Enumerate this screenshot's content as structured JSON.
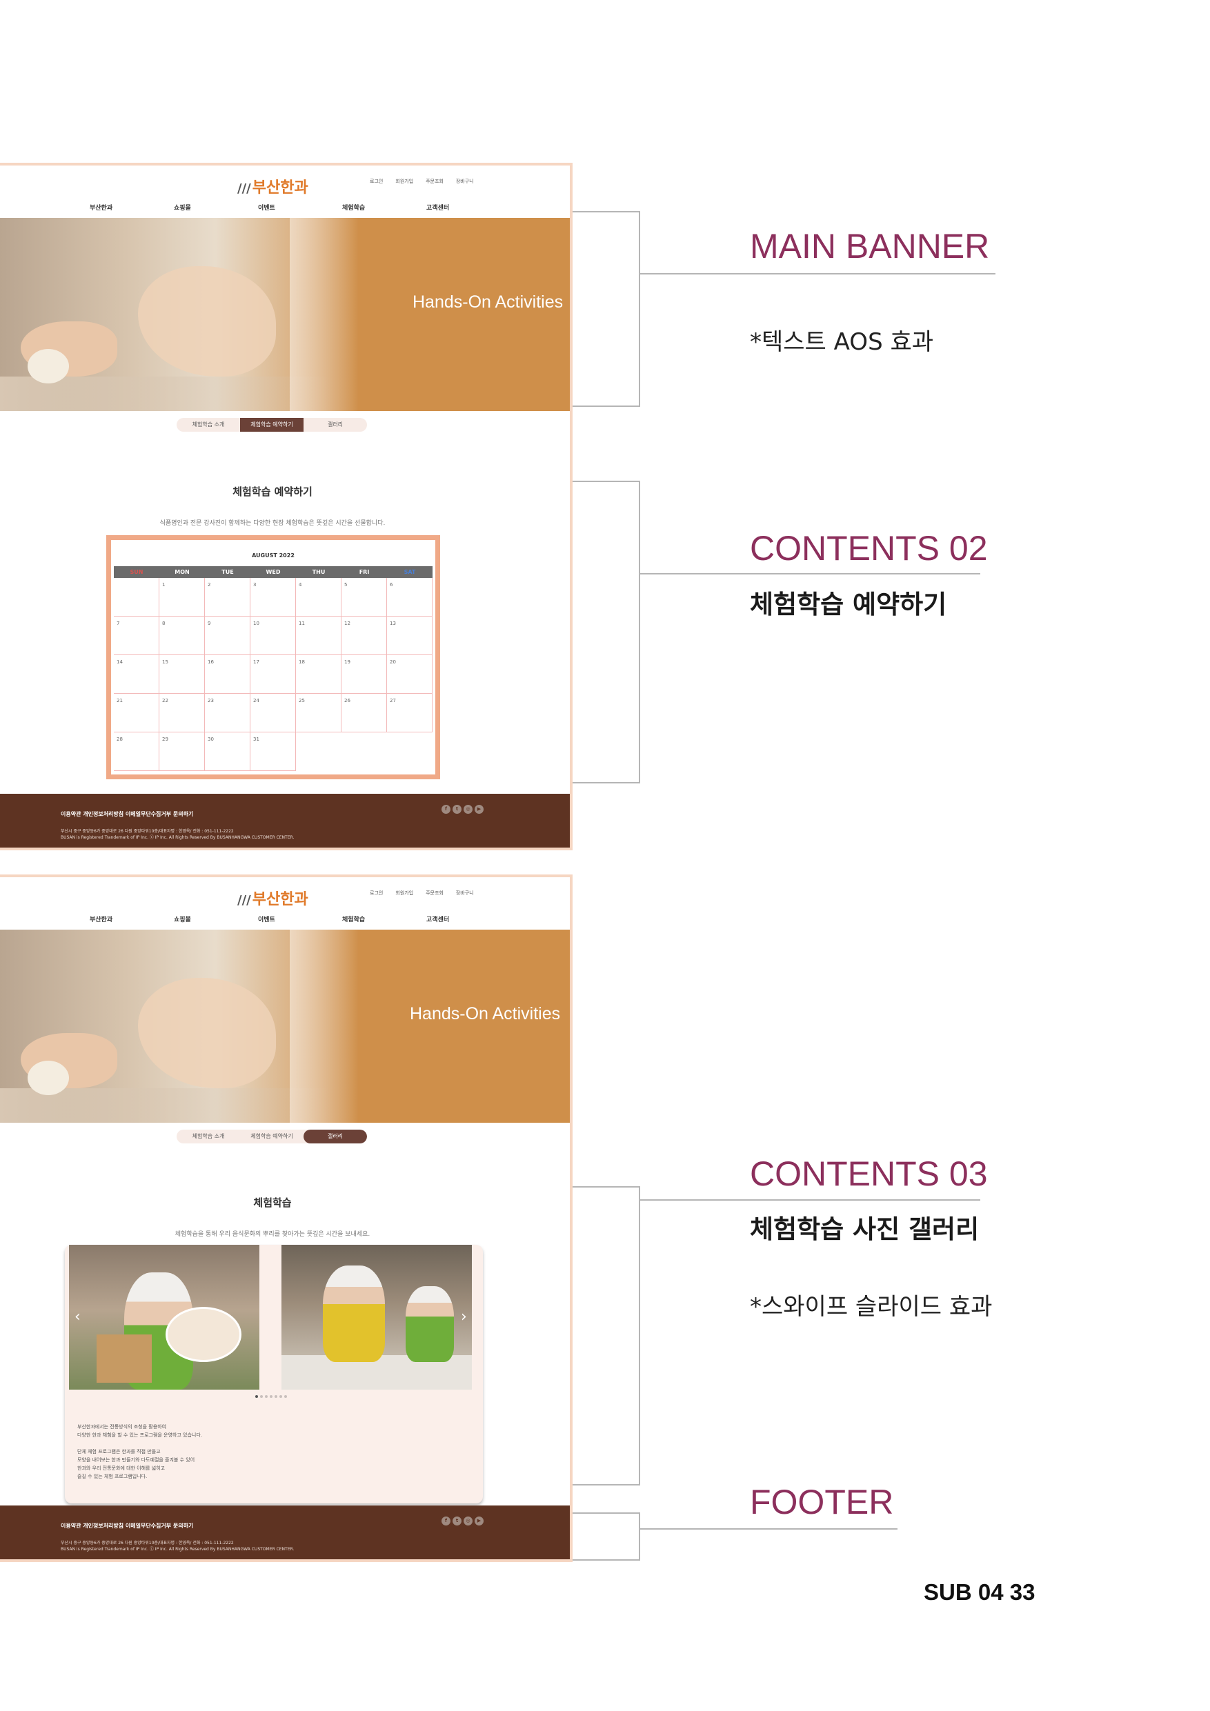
{
  "site": {
    "logo": "부산한과",
    "top_links": [
      "로그인",
      "회원가입",
      "주문조회",
      "장바구니"
    ],
    "gnb": [
      "부산한과",
      "쇼핑몰",
      "이벤트",
      "체험학습",
      "고객센터"
    ],
    "banner_title": "Hands-On Activities",
    "tabs": [
      "체험학습 소개",
      "체험학습 예약하기",
      "갤러리"
    ],
    "footer": {
      "links": "이용약관  개인정보처리방침  이메일무단수집거부  문의하기",
      "address": "부산시 중구 중앙동6가 중앙대로 26 다원 중앙타워10층/대표자명 : 한영옥/ 전화 : 051-111-2222",
      "copyright": "BUSAN is Registered Trandemark of IP Inc. ⓒ IP Inc. All Rights Reserved By BUSANHANGWA CUSTOMER CENTER.",
      "social_icons": [
        "facebook-icon",
        "twitter-icon",
        "instagram-icon",
        "youtube-icon"
      ]
    }
  },
  "mockup1": {
    "section_title": "체험학습 예약하기",
    "section_desc": "식품명인과 전문 강사진이 함께하는 다양한 현장 체험학습은 뜻깊은 시간을 선물합니다.",
    "calendar": {
      "month": "AUGUST 2022",
      "weekdays": [
        "SUN",
        "MON",
        "TUE",
        "WED",
        "THU",
        "FRI",
        "SAT"
      ],
      "days": [
        "",
        "1",
        "2",
        "3",
        "4",
        "5",
        "6",
        "7",
        "8",
        "9",
        "10",
        "11",
        "12",
        "13",
        "14",
        "15",
        "16",
        "17",
        "18",
        "19",
        "20",
        "21",
        "22",
        "23",
        "24",
        "25",
        "26",
        "27",
        "28",
        "29",
        "30",
        "31"
      ]
    }
  },
  "mockup2": {
    "section_title": "체험학습",
    "section_desc": "체험학습을 통해 우리 음식문화의 뿌리를 찾아가는 뜻깊은 시간을 보내세요.",
    "gallery_text": [
      [
        "부산한과에서는 전통방식의 조청을 활용하여",
        "다양한 한과 체험을 할 수 있는 프로그램을 운영하고 있습니다."
      ],
      [
        "단체 체험 프로그램은 한과를 직접 만들고",
        "모양을 내어보는 한과 만들기와 다도예절을 즐겨볼 수 있어",
        "한과와 우리 전통문화에 대한 이해를 넓히고",
        "즐길 수 있는 체험 프로그램입니다."
      ]
    ],
    "slider_dots": 7
  },
  "annotations": {
    "main_banner": "MAIN BANNER",
    "main_banner_note": "*텍스트 AOS 효과",
    "contents02": "CONTENTS 02",
    "contents02_sub": "체험학습 예약하기",
    "contents03": "CONTENTS 03",
    "contents03_sub": "체험학습 사진 갤러리",
    "contents03_note": "*스와이프 슬라이드 효과",
    "footer": "FOOTER",
    "page_label": "SUB 04   33"
  },
  "colors": {
    "accent_title": "#8c2f5c",
    "banner_orange": "#cf8f4a",
    "footer_brown": "#5e3322",
    "tab_active": "#6b4137",
    "calendar_border": "#f0a987"
  }
}
